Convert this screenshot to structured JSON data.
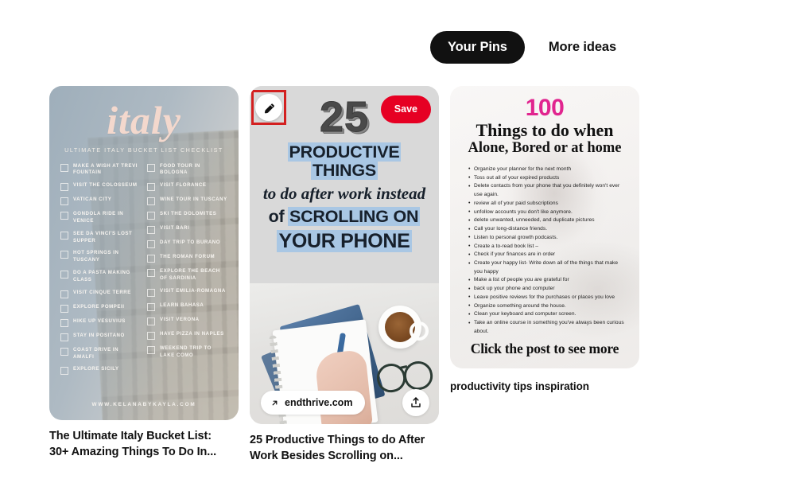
{
  "tabs": [
    {
      "label": "Your Pins",
      "active": true
    },
    {
      "label": "More ideas",
      "active": false
    }
  ],
  "pins": [
    {
      "caption": "The Ultimate Italy Bucket List: 30+ Amazing Things To Do In...",
      "title": "italy",
      "subtitle": "ULTIMATE ITALY BUCKET LIST CHECKLIST",
      "footer": "WWW.KELANABYKAYLA.COM",
      "checklist_left": [
        "MAKE A WISH AT TREVI FOUNTAIN",
        "VISIT THE COLOSSEUM",
        "VATICAN CITY",
        "GONDOLA RIDE IN VENICE",
        "SEE DA VINCI'S LOST SUPPER",
        "HOT SPRINGS IN TUSCANY",
        "DO A PASTA MAKING CLASS",
        "VISIT CINQUE TERRE",
        "EXPLORE POMPEII",
        "HIKE UP VESUVIUS",
        "STAY IN POSITANO",
        "COAST DRIVE IN AMALFI",
        "EXPLORE SICILY"
      ],
      "checklist_right": [
        "FOOD TOUR IN BOLOGNA",
        "VISIT FLORANCE",
        "WINE TOUR IN TUSCANY",
        "SKI THE DOLOMITES",
        "VISIT BARI",
        "DAY TRIP TO BURANO",
        "THE ROMAN FORUM",
        "EXPLORE THE BEACH OF SARDINIA",
        "VISIT EMILIA-ROMAGNA",
        "LEARN BAHASA",
        "VISIT VERONA",
        "HAVE PIZZA IN NAPLES",
        "WEEKEND TRIP TO LAKE COMO"
      ]
    },
    {
      "caption": "25 Productive Things to do After Work Besides Scrolling on...",
      "number": "25",
      "line1": "PRODUCTIVE THINGS",
      "line2": "to do after work instead",
      "line3_italic": "of",
      "line3": "SCROLLING ON",
      "line4": "YOUR PHONE",
      "save_label": "Save",
      "domain": "endthrive.com",
      "edit_icon": "pencil-icon",
      "share_icon": "share-icon",
      "external_link_icon": "arrow-up-right-icon",
      "highlight_color": "#d32020",
      "save_color": "#e60023"
    },
    {
      "caption": "productivity tips inspiration",
      "number": "100",
      "number_color": "#e1258f",
      "heading_line1": "Things to do when",
      "heading_line2": "Alone, Bored or at home",
      "cta": "Click the post to see more",
      "items": [
        "Organize your planner for the next month",
        "Toss out all of your expired products",
        "Delete contacts from your phone that you definitely won't ever use again.",
        "review all of your paid subscriptions",
        "unfollow accounts you don't like anymore.",
        " delete unwanted, unneeded, and duplicate pictures",
        "Call your long-distance friends.",
        "Listen to personal growth podcasts.",
        "Create a to-read book list –",
        "Check if your finances are in order",
        "Create your happy list- Write down all of the things that make you happy",
        "Make a list of people you are grateful for",
        "back up your phone and computer",
        "Leave positive reviews for the purchases or places you love",
        "Organize something around the house.",
        "Clean your keyboard and computer screen.",
        "Take an online course in something you've always been curious about."
      ]
    }
  ]
}
